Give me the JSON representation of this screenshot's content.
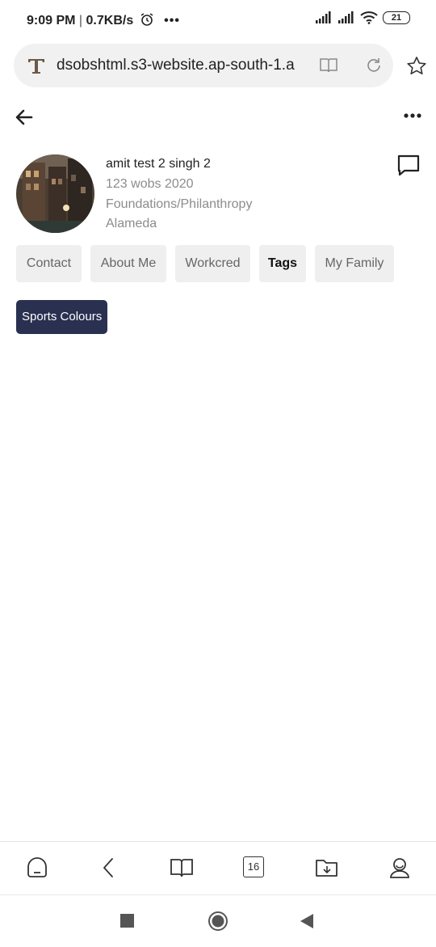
{
  "status_bar": {
    "time": "9:09 PM",
    "speed": "0.7KB/s",
    "battery": "21"
  },
  "browser": {
    "url": "dsobshtml.s3-website.ap-south-1.a",
    "logo_letter": "T"
  },
  "profile": {
    "name": "amit test 2 singh 2",
    "line1": "123 wobs 2020",
    "line2": "Foundations/Philanthropy",
    "line3": "Alameda"
  },
  "tabs": [
    {
      "label": "Contact"
    },
    {
      "label": "About Me"
    },
    {
      "label": "Workcred"
    },
    {
      "label": "Tags"
    },
    {
      "label": "My Family"
    }
  ],
  "active_tab": "Tags",
  "tags": [
    "Sports Colours"
  ],
  "bottom_nav": {
    "tabs_count": "16"
  },
  "colors": {
    "tag_bg": "#2a3050",
    "tab_bg": "#efefef",
    "muted_text": "#8c8c8c"
  }
}
